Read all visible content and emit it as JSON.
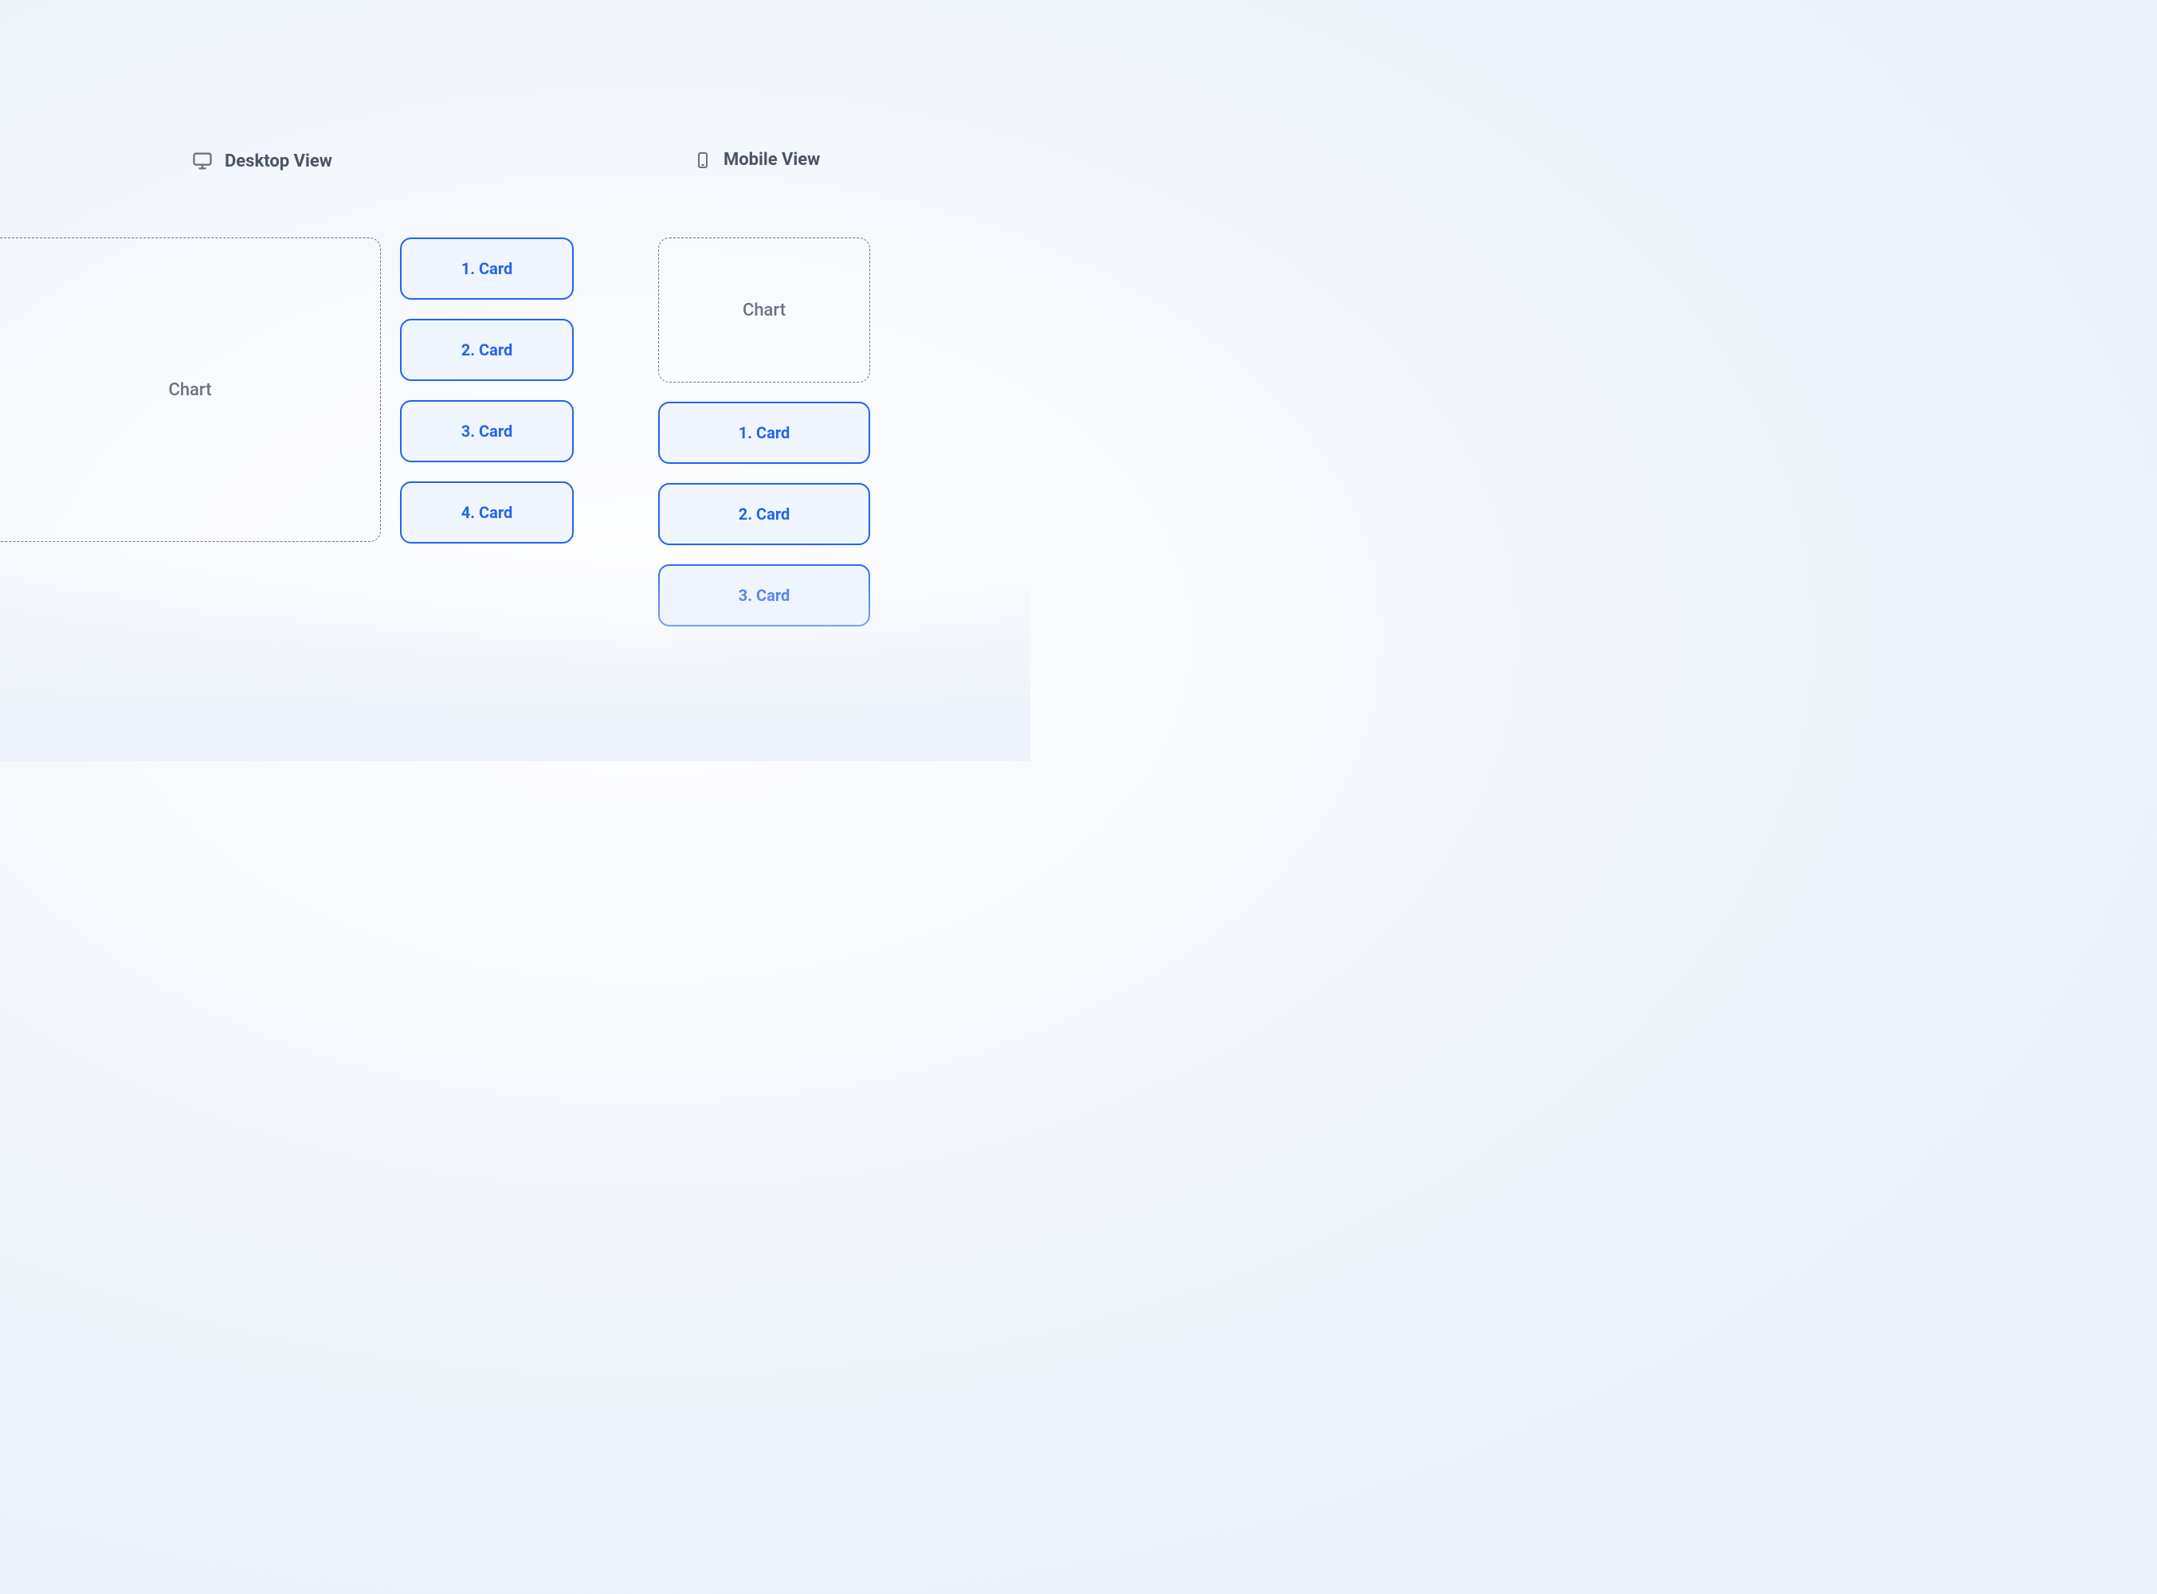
{
  "desktop": {
    "title": "Desktop View",
    "chart_label": "Chart",
    "cards": [
      {
        "label": "1. Card"
      },
      {
        "label": "2. Card"
      },
      {
        "label": "3. Card"
      },
      {
        "label": "4. Card"
      }
    ]
  },
  "mobile": {
    "title": "Mobile View",
    "chart_label": "Chart",
    "cards": [
      {
        "label": "1. Card"
      },
      {
        "label": "2. Card"
      },
      {
        "label": "3. Card"
      }
    ]
  }
}
